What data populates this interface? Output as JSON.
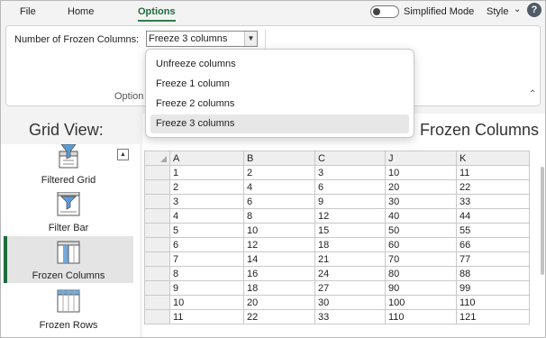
{
  "menu": {
    "tabs": [
      "File",
      "Home",
      "Options"
    ],
    "active_tab": "Options",
    "simplified_mode_label": "Simplified Mode",
    "simplified_mode_on": false,
    "style_label": "Style",
    "help": "?"
  },
  "ribbon": {
    "frozen_columns_label": "Number of Frozen Columns:",
    "frozen_columns_value": "Freeze 3 columns",
    "group_label": "Option"
  },
  "dropdown": {
    "options": [
      "Unfreeze columns",
      "Freeze 1 column",
      "Freeze 2 columns",
      "Freeze 3 columns"
    ],
    "selected": "Freeze 3 columns"
  },
  "sidebar": {
    "title": "Grid View:",
    "items": [
      {
        "label": "Filtered Grid",
        "icon": "filter-grid-icon"
      },
      {
        "label": "Filter Bar",
        "icon": "filter-bar-icon"
      },
      {
        "label": "Frozen Columns",
        "icon": "frozen-columns-icon"
      },
      {
        "label": "Frozen Rows",
        "icon": "frozen-rows-icon"
      }
    ],
    "active_item": "Frozen Columns"
  },
  "content": {
    "title": "Frozen Columns",
    "columns": [
      "A",
      "B",
      "C",
      "J",
      "K"
    ],
    "rows": [
      [
        "1",
        "2",
        "3",
        "10",
        "11"
      ],
      [
        "2",
        "4",
        "6",
        "20",
        "22"
      ],
      [
        "3",
        "6",
        "9",
        "30",
        "33"
      ],
      [
        "4",
        "8",
        "12",
        "40",
        "44"
      ],
      [
        "5",
        "10",
        "15",
        "50",
        "55"
      ],
      [
        "6",
        "12",
        "18",
        "60",
        "66"
      ],
      [
        "7",
        "14",
        "21",
        "70",
        "77"
      ],
      [
        "8",
        "16",
        "24",
        "80",
        "88"
      ],
      [
        "9",
        "18",
        "27",
        "90",
        "99"
      ],
      [
        "10",
        "20",
        "30",
        "100",
        "110"
      ],
      [
        "11",
        "22",
        "33",
        "110",
        "121"
      ]
    ]
  },
  "colors": {
    "accent": "#1f6b3d",
    "active_item_bg": "#e4e4e4"
  }
}
